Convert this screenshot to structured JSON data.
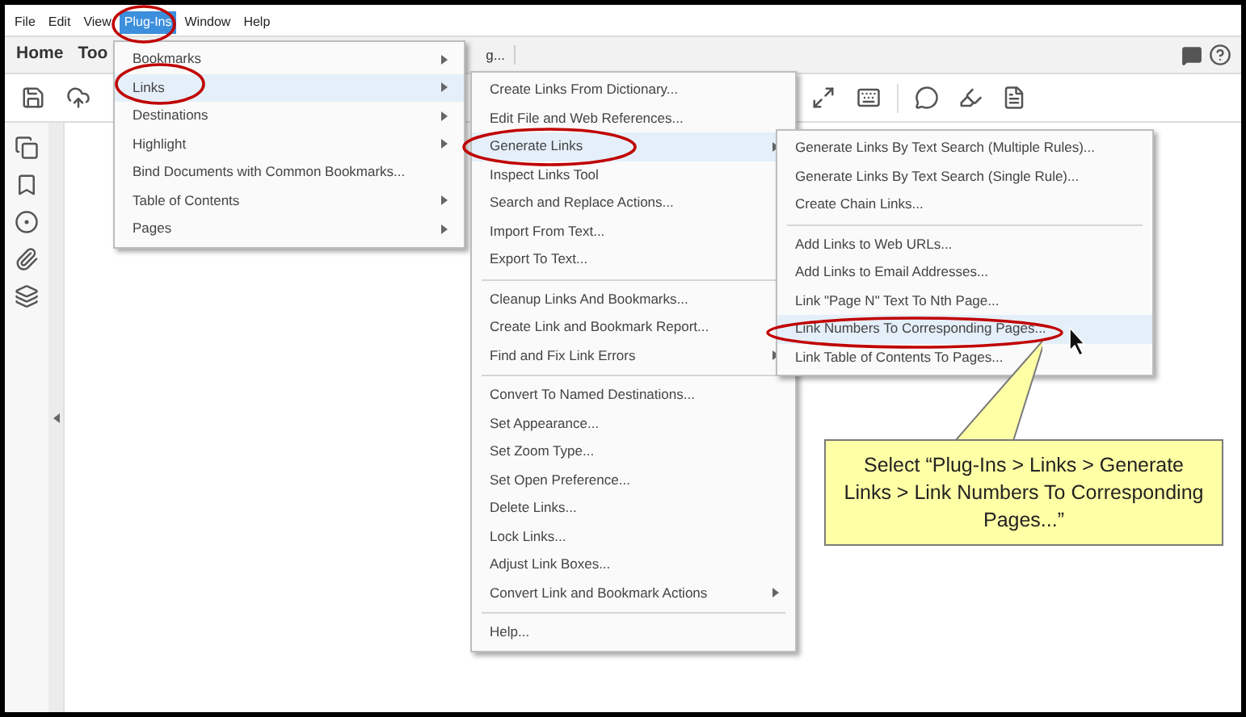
{
  "menubar": [
    {
      "label": "File",
      "selected": false
    },
    {
      "label": "Edit",
      "selected": false
    },
    {
      "label": "View",
      "selected": false
    },
    {
      "label": "Plug-Ins",
      "selected": true
    },
    {
      "label": "Window",
      "selected": false
    },
    {
      "label": "Help",
      "selected": false
    }
  ],
  "tabs": [
    {
      "label": "Home"
    },
    {
      "label": "Too"
    },
    {
      "label": "g..."
    }
  ],
  "plugins_menu": [
    [
      {
        "label": "Bookmarks",
        "submenu": true,
        "selected": false
      },
      {
        "label": "Links",
        "submenu": true,
        "selected": true
      },
      {
        "label": "Destinations",
        "submenu": true,
        "selected": false
      },
      {
        "label": "Highlight",
        "submenu": true,
        "selected": false
      },
      {
        "label": "Bind Documents with Common Bookmarks...",
        "submenu": false,
        "selected": false
      },
      {
        "label": "Table of Contents",
        "submenu": true,
        "selected": false
      },
      {
        "label": "Pages",
        "submenu": true,
        "selected": false
      }
    ]
  ],
  "links_menu": [
    [
      {
        "label": "Create Links From Dictionary...",
        "submenu": false,
        "selected": false
      },
      {
        "label": "Edit File and Web References...",
        "submenu": false,
        "selected": false
      },
      {
        "label": "Generate Links",
        "submenu": true,
        "selected": true
      },
      {
        "label": "Inspect Links Tool",
        "submenu": false,
        "selected": false
      },
      {
        "label": "Search and Replace Actions...",
        "submenu": false,
        "selected": false
      },
      {
        "label": "Import From Text...",
        "submenu": false,
        "selected": false
      },
      {
        "label": "Export To Text...",
        "submenu": false,
        "selected": false
      }
    ],
    [
      {
        "label": "Cleanup Links And Bookmarks...",
        "submenu": false,
        "selected": false
      },
      {
        "label": "Create Link and Bookmark Report...",
        "submenu": false,
        "selected": false
      },
      {
        "label": "Find and Fix Link Errors",
        "submenu": true,
        "selected": false
      }
    ],
    [
      {
        "label": "Convert To Named Destinations...",
        "submenu": false,
        "selected": false
      },
      {
        "label": "Set Appearance...",
        "submenu": false,
        "selected": false
      },
      {
        "label": "Set Zoom Type...",
        "submenu": false,
        "selected": false
      },
      {
        "label": "Set Open Preference...",
        "submenu": false,
        "selected": false
      },
      {
        "label": "Delete Links...",
        "submenu": false,
        "selected": false
      },
      {
        "label": "Lock Links...",
        "submenu": false,
        "selected": false
      },
      {
        "label": "Adjust Link Boxes...",
        "submenu": false,
        "selected": false
      },
      {
        "label": "Convert Link and Bookmark Actions",
        "submenu": true,
        "selected": false
      }
    ],
    [
      {
        "label": "Help...",
        "submenu": false,
        "selected": false
      }
    ]
  ],
  "generate_links_menu": [
    [
      {
        "label": "Generate Links By Text Search (Multiple Rules)...",
        "submenu": false,
        "selected": false
      },
      {
        "label": "Generate Links By Text Search (Single Rule)...",
        "submenu": false,
        "selected": false
      },
      {
        "label": "Create Chain Links...",
        "submenu": false,
        "selected": false
      }
    ],
    [
      {
        "label": "Add Links to Web URLs...",
        "submenu": false,
        "selected": false
      },
      {
        "label": "Add Links to Email Addresses...",
        "submenu": false,
        "selected": false
      },
      {
        "label": "Link \"Page N\" Text To Nth Page...",
        "submenu": false,
        "selected": false
      },
      {
        "label": "Link Numbers To Corresponding Pages...",
        "submenu": false,
        "selected": true
      },
      {
        "label": "Link Table of Contents To Pages...",
        "submenu": false,
        "selected": false
      }
    ]
  ],
  "callout": {
    "text": "Select “Plug-Ins > Links > Generate Links > Link Numbers To Corresponding Pages...”"
  }
}
